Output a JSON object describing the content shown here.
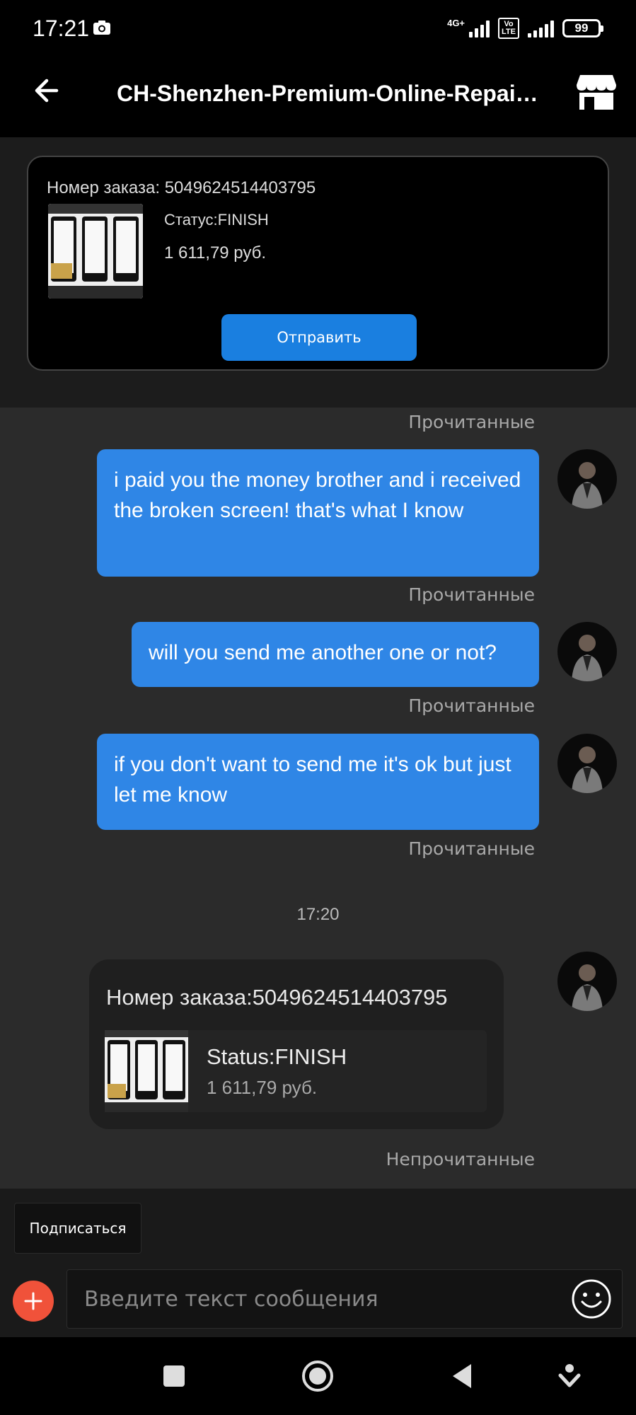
{
  "status_bar": {
    "time": "17:21",
    "network": "4G+",
    "lte_label": "VoLTE",
    "battery": "99"
  },
  "header": {
    "title": "CH-Shenzhen-Premium-Online-Repair-...",
    "back_icon": "arrow-left-icon",
    "store_icon": "store-icon"
  },
  "order_card": {
    "order_number": "Номер заказа: 5049624514403795",
    "status": "Статус:FINISH",
    "price": "1 611,79 руб.",
    "send_button": "Отправить"
  },
  "messages": [
    {
      "read_label": "Прочитанные"
    },
    {
      "text": "i paid you the money brother and i received the broken screen! that's what I know",
      "read_label": "Прочитанные"
    },
    {
      "text": "will you send me another one or not?",
      "read_label": "Прочитанные"
    },
    {
      "text": "if you don't want to send me it's ok but just let me know",
      "read_label": "Прочитанные"
    }
  ],
  "timestamp": "17:20",
  "order_message": {
    "order_number": "Номер заказа:5049624514403795",
    "status": "Status:FINISH",
    "price": "1 611,79 руб.",
    "unread_label": "Непрочитанные"
  },
  "bottom": {
    "subscribe_button": "Подписаться",
    "input_placeholder": "Введите текст сообщения",
    "plus_icon": "plus-icon",
    "emoji_icon": "emoji-icon"
  },
  "colors": {
    "accent_blue": "#2f86e6",
    "button_blue": "#1a7fe0",
    "plus_red": "#f0523a"
  }
}
